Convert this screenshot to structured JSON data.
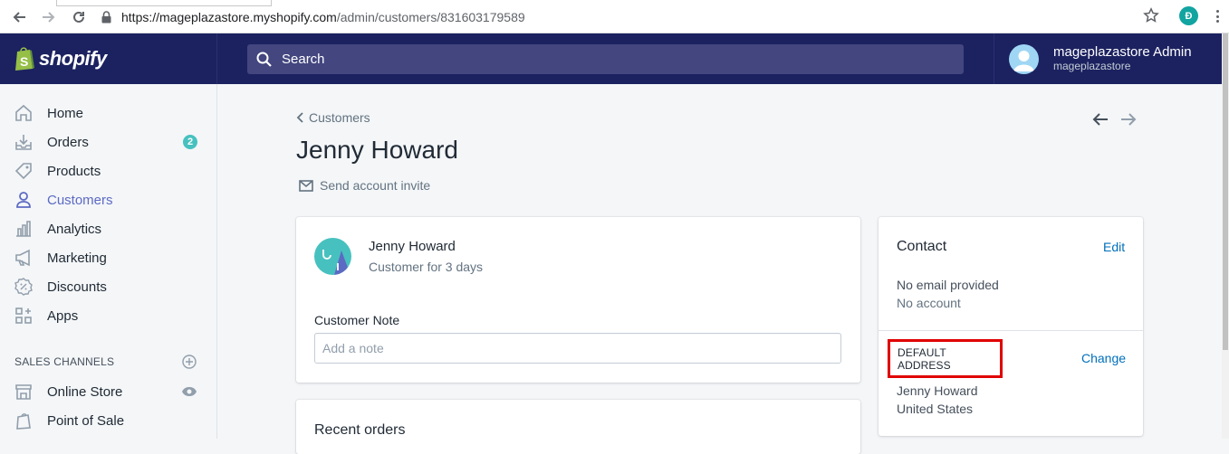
{
  "browser": {
    "url_host": "https://mageplazastore.myshopify.com",
    "url_path": "/admin/customers/831603179589",
    "profile_initial": "Đ"
  },
  "topbar": {
    "logo_text": "shopify",
    "search_placeholder": "Search",
    "account_name": "mageplazastore Admin",
    "account_store": "mageplazastore"
  },
  "sidebar": {
    "items": [
      {
        "label": "Home",
        "icon": "home-icon"
      },
      {
        "label": "Orders",
        "icon": "orders-icon",
        "badge": "2"
      },
      {
        "label": "Products",
        "icon": "tag-icon"
      },
      {
        "label": "Customers",
        "icon": "person-icon",
        "active": true
      },
      {
        "label": "Analytics",
        "icon": "bar-chart-icon"
      },
      {
        "label": "Marketing",
        "icon": "megaphone-icon"
      },
      {
        "label": "Discounts",
        "icon": "discount-icon"
      },
      {
        "label": "Apps",
        "icon": "apps-icon"
      }
    ],
    "sales_channels_heading": "SALES CHANNELS",
    "channels": [
      {
        "label": "Online Store",
        "icon": "store-icon"
      },
      {
        "label": "Point of Sale",
        "icon": "pos-icon"
      }
    ]
  },
  "main": {
    "breadcrumb": "Customers",
    "title": "Jenny Howard",
    "invite_label": "Send account invite",
    "customer_card": {
      "name": "Jenny Howard",
      "since": "Customer for 3 days",
      "note_label": "Customer Note",
      "note_placeholder": "Add a note"
    },
    "recent_orders_title": "Recent orders",
    "contact": {
      "title": "Contact",
      "edit_label": "Edit",
      "email": "No email provided",
      "account": "No account",
      "default_address_heading": "DEFAULT ADDRESS",
      "change_label": "Change",
      "address_name": "Jenny Howard",
      "address_country": "United States"
    }
  },
  "colors": {
    "topbar": "#1c2260",
    "accent": "#5c6ac4",
    "link": "#006fbb",
    "badge": "#47c1bf",
    "highlight_box": "#e00000"
  }
}
